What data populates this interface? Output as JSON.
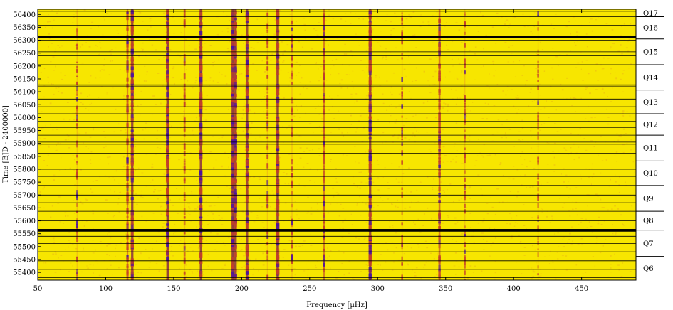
{
  "chart_data": {
    "type": "heatmap",
    "title": "",
    "xlabel": "Frequency [μHz]",
    "ylabel": "Time [BJD - 2400000]",
    "xlim": [
      50,
      490
    ],
    "ylim": [
      55370,
      56420
    ],
    "x_ticks": [
      50,
      100,
      150,
      200,
      250,
      300,
      350,
      400,
      450
    ],
    "y_ticks": [
      55400,
      55450,
      55500,
      55550,
      55600,
      55650,
      55700,
      55750,
      55800,
      55850,
      55900,
      55950,
      56000,
      56050,
      56100,
      56150,
      56200,
      56250,
      56300,
      56350,
      56400
    ],
    "grid": false,
    "colors": {
      "background": "#f7e600",
      "speckle": "#e8a020",
      "medium": "#c2402a",
      "strong": "#7a1a4a",
      "peak": "#4a12a0",
      "gap": "#000000"
    },
    "quarters": [
      {
        "label": "Q6",
        "start": 55370,
        "end": 55462
      },
      {
        "label": "Q7",
        "start": 55462,
        "end": 55562
      },
      {
        "label": "Q8",
        "start": 55566,
        "end": 55636
      },
      {
        "label": "Q9",
        "start": 55638,
        "end": 55737
      },
      {
        "label": "Q10",
        "start": 55737,
        "end": 55832
      },
      {
        "label": "Q11",
        "start": 55832,
        "end": 55932
      },
      {
        "label": "Q12",
        "start": 55932,
        "end": 56015
      },
      {
        "label": "Q13",
        "start": 56015,
        "end": 56107
      },
      {
        "label": "Q14",
        "start": 56107,
        "end": 56205
      },
      {
        "label": "Q15",
        "start": 56205,
        "end": 56305
      },
      {
        "label": "Q16",
        "start": 56305,
        "end": 56391
      },
      {
        "label": "Q17",
        "start": 56391,
        "end": 56420
      }
    ],
    "quarter_boundaries": [
      55462,
      55564,
      55637,
      55737,
      55832,
      55932,
      56015,
      56107,
      56205,
      56305,
      56391
    ],
    "segment_lines": [
      55380,
      55412,
      55445,
      55480,
      55512,
      55540,
      55562,
      55567,
      55600,
      55637,
      55670,
      55700,
      55737,
      55772,
      55800,
      55832,
      55862,
      55897,
      55905,
      55932,
      55962,
      55985,
      56015,
      56042,
      56072,
      56107,
      56122,
      56127,
      56165,
      56205,
      56240,
      56255,
      56300,
      56315,
      56358,
      56391,
      56412
    ],
    "thick_gaps": [
      55562,
      55564,
      56313
    ],
    "modes": [
      {
        "freq": 79,
        "strength": 0.25
      },
      {
        "freq": 116,
        "strength": 0.5
      },
      {
        "freq": 119.5,
        "strength": 0.9
      },
      {
        "freq": 145.5,
        "strength": 0.95
      },
      {
        "freq": 158,
        "strength": 0.3
      },
      {
        "freq": 170,
        "strength": 0.9
      },
      {
        "freq": 193.5,
        "strength": 1.0
      },
      {
        "freq": 195.5,
        "strength": 0.9
      },
      {
        "freq": 204,
        "strength": 0.85
      },
      {
        "freq": 219,
        "strength": 0.3
      },
      {
        "freq": 226.5,
        "strength": 1.0
      },
      {
        "freq": 237,
        "strength": 0.25
      },
      {
        "freq": 260.5,
        "strength": 0.55
      },
      {
        "freq": 294.5,
        "strength": 0.9
      },
      {
        "freq": 318,
        "strength": 0.2
      },
      {
        "freq": 345.5,
        "strength": 0.65
      },
      {
        "freq": 364,
        "strength": 0.3
      },
      {
        "freq": 418,
        "strength": 0.15
      }
    ]
  }
}
